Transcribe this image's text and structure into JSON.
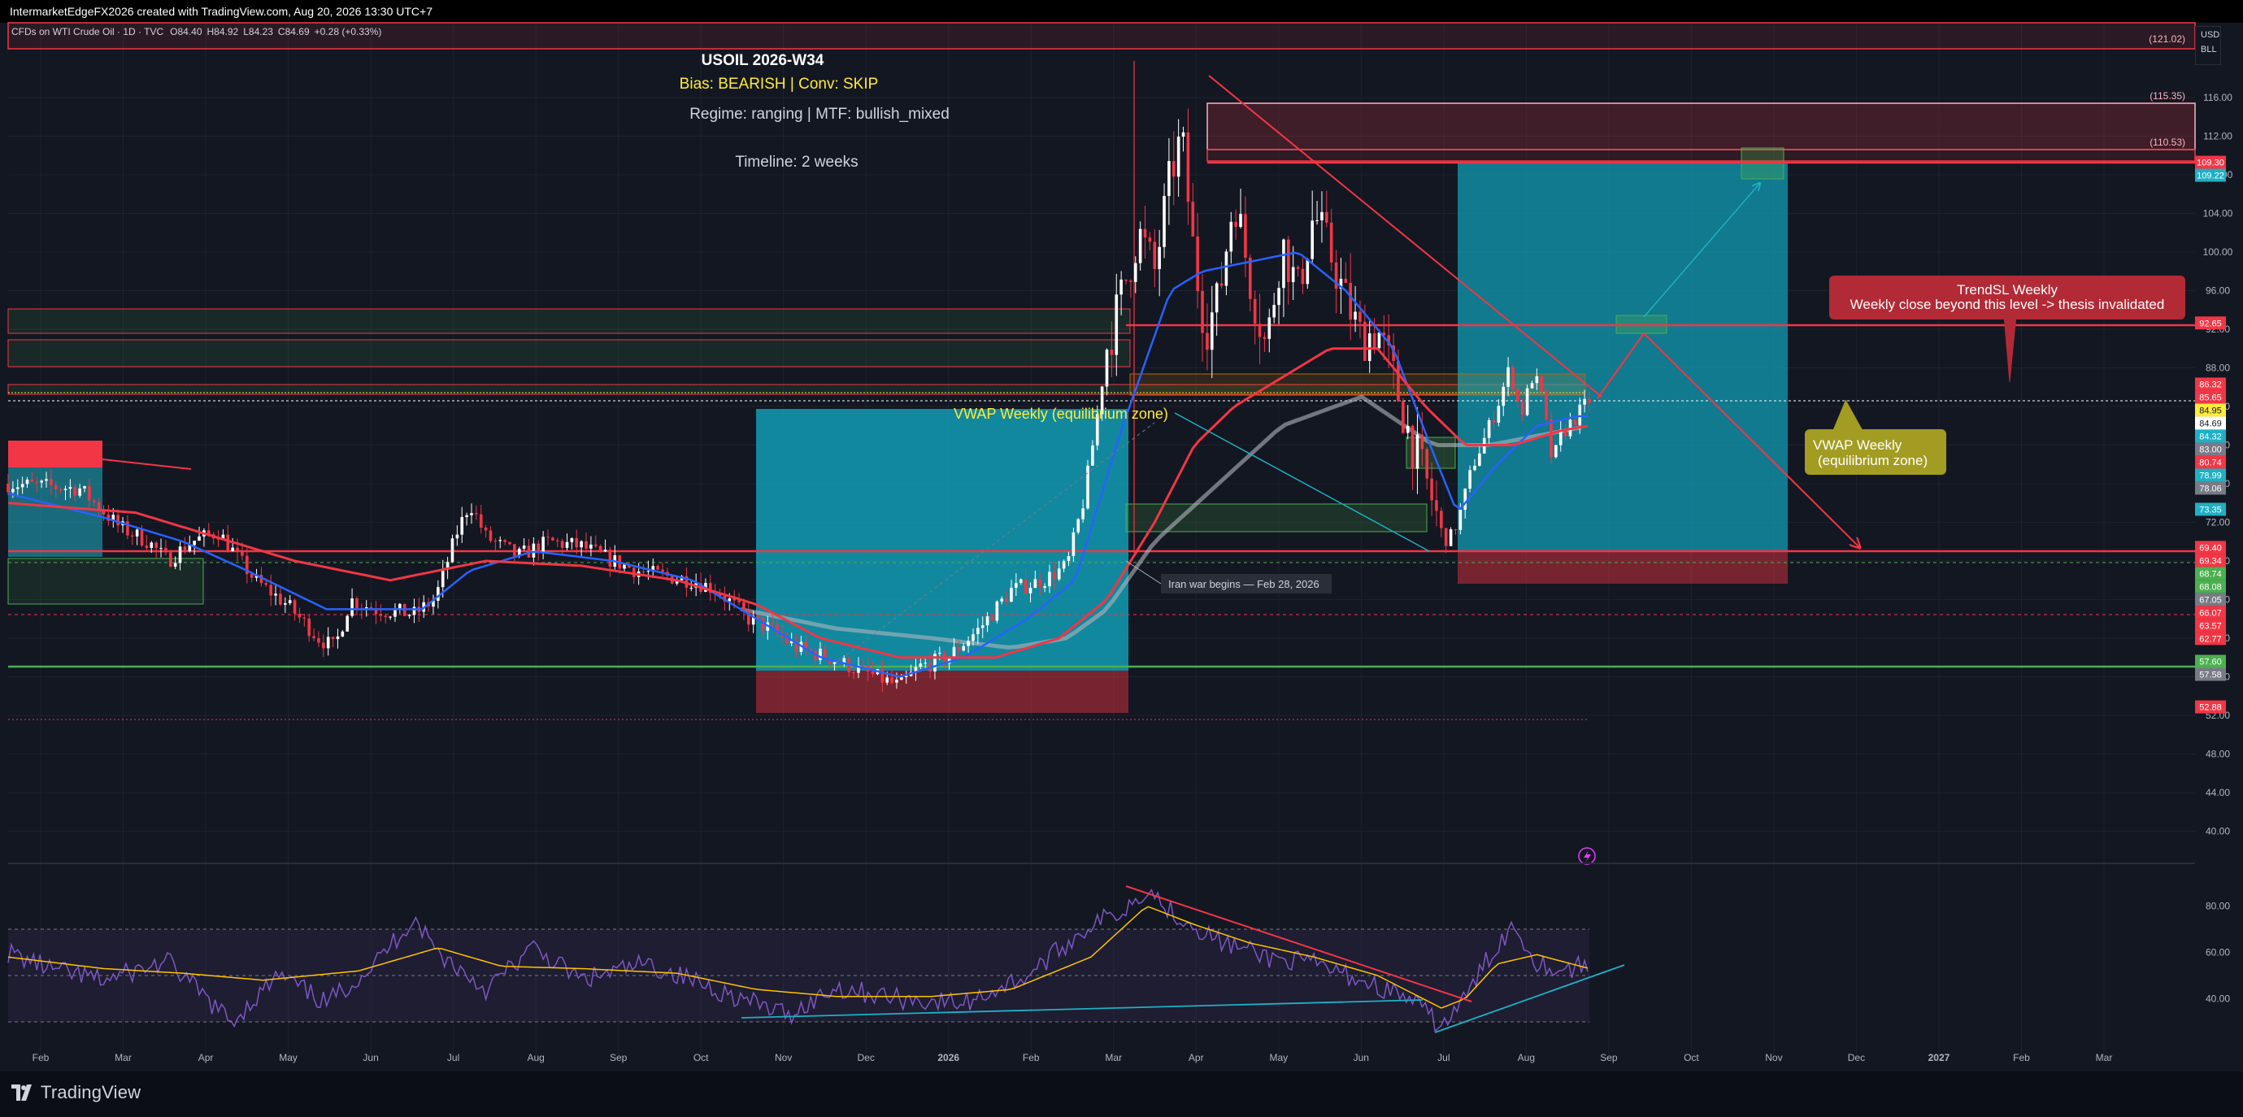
{
  "header": {
    "info": "IntermarketEdgeFX2026 created with TradingView.com, Aug 20, 2026 13:30 UTC+7"
  },
  "symbol_line": {
    "name": "CFDs on WTI Crude Oil · 1D · TVC",
    "o": "O84.40",
    "h": "H84.92",
    "l": "L84.23",
    "c": "C84.69",
    "chg": "+0.28 (+0.33%)"
  },
  "currency": {
    "top": "USD",
    "bottom": "BLL"
  },
  "footer": {
    "brand": "TradingView"
  },
  "colors": {
    "background": "#131722",
    "bull": "#ffffff",
    "bear": "#f23645",
    "accent_red": "#f23645",
    "accent_teal": "#1fb0c4",
    "accent_green": "#4caf50",
    "yellow_text": "#ffeb3b",
    "rsi": "#7e57c2"
  },
  "annotations": {
    "title": "USOIL 2026-W34",
    "bias": "Bias: BEARISH | Conv: SKIP",
    "regime": "Regime: ranging | MTF: bullish_mixed",
    "timeline": "Timeline: 2 weeks",
    "vwap_chart": "VWAP Weekly (equilibrium zone)",
    "vwap_callout_1": "VWAP Weekly",
    "vwap_callout_2": "(equilibrium zone)",
    "trendsl_1": "TrendSL Weekly",
    "trendsl_2": "Weekly close beyond this level -> thesis invalidated",
    "iran": "Iran war begins — Feb 28, 2026"
  },
  "zone_labels": [
    "(121.02)",
    "(115.35)",
    "(110.53)"
  ],
  "chart_data": [
    {
      "type": "candlestick",
      "x_labels": [
        "Feb",
        "Mar",
        "Apr",
        "May",
        "Jun",
        "Jul",
        "Aug",
        "Sep",
        "Oct",
        "Nov",
        "Dec",
        "2026",
        "Feb",
        "Mar",
        "Apr",
        "May",
        "Jun",
        "Jul",
        "Aug",
        "Sep",
        "Oct",
        "Nov",
        "Dec",
        "2027",
        "Feb",
        "Mar"
      ],
      "y_ticks": [
        "116.00",
        "112.00",
        "108.00",
        "104.00",
        "100.00",
        "96.00",
        "92.00",
        "88.00",
        "84.00",
        "80.00",
        "76.00",
        "72.00",
        "68.00",
        "64.00",
        "60.00",
        "56.00",
        "52.00",
        "48.00",
        "44.00",
        "40.00"
      ],
      "ylim": [
        38,
        122
      ],
      "last_price": 84.69,
      "price_badges": [
        {
          "label": "109.30",
          "color": "#f23645"
        },
        {
          "label": "109.22",
          "color": "#1fb0c4"
        },
        {
          "label": "92.65",
          "color": "#f23645"
        },
        {
          "label": "86.32",
          "color": "#f23645"
        },
        {
          "label": "85.65",
          "color": "#f23645"
        },
        {
          "label": "84.95",
          "color": "#ffeb3b"
        },
        {
          "label": "84.69",
          "color": "#ffffff"
        },
        {
          "label": "84.32",
          "color": "#1fb0c4"
        },
        {
          "label": "83.00",
          "color": "#787b86"
        },
        {
          "label": "80.74",
          "color": "#f23645"
        },
        {
          "label": "78.99",
          "color": "#1fb0c4"
        },
        {
          "label": "78.06",
          "color": "#787b86"
        },
        {
          "label": "73.35",
          "color": "#1fb0c4"
        },
        {
          "label": "69.40",
          "color": "#f23645"
        },
        {
          "label": "69.34",
          "color": "#f23645"
        },
        {
          "label": "68.74",
          "color": "#4caf50"
        },
        {
          "label": "68.08",
          "color": "#4caf50"
        },
        {
          "label": "67.05",
          "color": "#787b86"
        },
        {
          "label": "66.07",
          "color": "#f23645"
        },
        {
          "label": "63.57",
          "color": "#f23645"
        },
        {
          "label": "62.77",
          "color": "#f23645"
        },
        {
          "label": "57.60",
          "color": "#4caf50"
        },
        {
          "label": "57.58",
          "color": "#787b86"
        },
        {
          "label": "52.88",
          "color": "#f23645"
        }
      ],
      "close_anchors": [
        [
          0,
          76
        ],
        [
          45,
          75.5
        ],
        [
          70,
          71.5
        ],
        [
          88,
          70
        ],
        [
          100,
          68
        ],
        [
          115,
          70
        ],
        [
          132,
          71
        ],
        [
          155,
          66
        ],
        [
          175,
          63.5
        ],
        [
          195,
          60
        ],
        [
          205,
          59
        ],
        [
          215,
          64
        ],
        [
          230,
          63
        ],
        [
          255,
          62.5
        ],
        [
          268,
          64
        ],
        [
          282,
          71
        ],
        [
          290,
          74
        ],
        [
          300,
          70.5
        ],
        [
          320,
          68.5
        ],
        [
          340,
          70
        ],
        [
          360,
          69.5
        ],
        [
          380,
          68
        ],
        [
          395,
          67
        ],
        [
          410,
          66.5
        ],
        [
          430,
          66
        ],
        [
          445,
          65
        ],
        [
          465,
          62
        ],
        [
          478,
          61
        ],
        [
          495,
          59
        ],
        [
          515,
          58
        ],
        [
          530,
          57
        ],
        [
          545,
          56
        ],
        [
          560,
          55
        ],
        [
          572,
          57
        ],
        [
          590,
          58
        ],
        [
          610,
          61
        ],
        [
          630,
          65
        ],
        [
          650,
          66
        ],
        [
          665,
          67.5
        ],
        [
          675,
          74
        ],
        [
          683,
          82
        ],
        [
          690,
          90
        ],
        [
          700,
          96
        ],
        [
          710,
          102
        ],
        [
          720,
          98
        ],
        [
          730,
          108
        ],
        [
          737,
          112
        ],
        [
          745,
          99
        ],
        [
          752,
          92
        ],
        [
          760,
          95
        ],
        [
          770,
          106
        ],
        [
          780,
          97
        ],
        [
          790,
          90
        ],
        [
          800,
          101
        ],
        [
          810,
          96
        ],
        [
          820,
          104
        ],
        [
          830,
          100
        ],
        [
          840,
          95
        ],
        [
          850,
          91
        ],
        [
          860,
          92
        ],
        [
          870,
          87
        ],
        [
          880,
          81
        ],
        [
          893,
          75
        ],
        [
          900,
          71
        ],
        [
          905,
          70
        ],
        [
          912,
          73
        ],
        [
          920,
          78
        ],
        [
          928,
          81
        ],
        [
          935,
          84
        ],
        [
          943,
          88
        ],
        [
          950,
          83
        ],
        [
          957,
          87
        ],
        [
          962,
          86
        ],
        [
          970,
          78
        ],
        [
          975,
          81
        ],
        [
          985,
          83
        ],
        [
          993,
          84.69
        ]
      ],
      "sma_fast_anchors": [
        [
          0,
          75
        ],
        [
          60,
          72.5
        ],
        [
          110,
          70
        ],
        [
          150,
          67
        ],
        [
          200,
          63
        ],
        [
          260,
          63
        ],
        [
          290,
          67
        ],
        [
          330,
          69
        ],
        [
          380,
          68
        ],
        [
          430,
          66
        ],
        [
          470,
          62
        ],
        [
          510,
          58
        ],
        [
          560,
          56
        ],
        [
          600,
          58
        ],
        [
          640,
          62
        ],
        [
          670,
          66
        ],
        [
          700,
          82
        ],
        [
          730,
          96
        ],
        [
          750,
          98
        ],
        [
          780,
          99
        ],
        [
          810,
          100
        ],
        [
          840,
          96
        ],
        [
          870,
          90
        ],
        [
          893,
          80
        ],
        [
          910,
          73
        ],
        [
          935,
          78
        ],
        [
          960,
          82
        ],
        [
          985,
          83
        ],
        [
          993,
          83
        ]
      ],
      "sma_slow_anchors": [
        [
          0,
          74
        ],
        [
          80,
          73
        ],
        [
          120,
          71
        ],
        [
          180,
          68
        ],
        [
          240,
          66
        ],
        [
          300,
          68
        ],
        [
          360,
          67.5
        ],
        [
          420,
          66
        ],
        [
          470,
          63.5
        ],
        [
          510,
          60
        ],
        [
          560,
          58
        ],
        [
          620,
          58
        ],
        [
          660,
          60
        ],
        [
          690,
          64
        ],
        [
          720,
          72
        ],
        [
          745,
          80
        ],
        [
          770,
          84
        ],
        [
          800,
          87
        ],
        [
          830,
          90
        ],
        [
          860,
          90
        ],
        [
          890,
          84
        ],
        [
          915,
          80
        ],
        [
          945,
          80
        ],
        [
          975,
          81.5
        ],
        [
          993,
          82
        ]
      ],
      "vwap_band_anchors": [
        [
          460,
          63
        ],
        [
          520,
          61
        ],
        [
          580,
          60
        ],
        [
          630,
          59
        ],
        [
          665,
          60
        ],
        [
          690,
          63
        ],
        [
          720,
          70
        ],
        [
          760,
          76
        ],
        [
          800,
          82
        ],
        [
          850,
          85
        ],
        [
          895,
          80
        ],
        [
          930,
          80
        ],
        [
          993,
          82
        ]
      ],
      "annotated_levels": [
        121.02,
        115.35,
        110.53,
        92.65,
        84.95,
        69.4,
        57.6
      ]
    },
    {
      "type": "line",
      "name": "RSI",
      "y_ticks": [
        "80.00",
        "60.00",
        "40.00"
      ],
      "ylim": [
        15,
        100
      ],
      "bands": [
        70,
        50,
        30
      ],
      "rsi_anchors": [
        [
          0,
          60
        ],
        [
          30,
          52
        ],
        [
          60,
          48
        ],
        [
          100,
          56
        ],
        [
          140,
          30
        ],
        [
          170,
          50
        ],
        [
          200,
          38
        ],
        [
          230,
          55
        ],
        [
          255,
          75
        ],
        [
          270,
          60
        ],
        [
          300,
          44
        ],
        [
          330,
          62
        ],
        [
          360,
          48
        ],
        [
          400,
          55
        ],
        [
          430,
          48
        ],
        [
          460,
          40
        ],
        [
          490,
          33
        ],
        [
          520,
          45
        ],
        [
          560,
          40
        ],
        [
          600,
          38
        ],
        [
          640,
          50
        ],
        [
          680,
          72
        ],
        [
          700,
          78
        ],
        [
          715,
          88
        ],
        [
          730,
          78
        ],
        [
          760,
          65
        ],
        [
          790,
          58
        ],
        [
          820,
          55
        ],
        [
          850,
          48
        ],
        [
          880,
          40
        ],
        [
          900,
          28
        ],
        [
          915,
          40
        ],
        [
          930,
          58
        ],
        [
          945,
          72
        ],
        [
          960,
          56
        ],
        [
          975,
          52
        ],
        [
          993,
          55
        ]
      ],
      "signal_anchors": [
        [
          0,
          58
        ],
        [
          60,
          53
        ],
        [
          110,
          51
        ],
        [
          160,
          48
        ],
        [
          220,
          52
        ],
        [
          270,
          62
        ],
        [
          310,
          54
        ],
        [
          360,
          53
        ],
        [
          420,
          51
        ],
        [
          470,
          44
        ],
        [
          520,
          41
        ],
        [
          580,
          41
        ],
        [
          630,
          44
        ],
        [
          680,
          58
        ],
        [
          715,
          80
        ],
        [
          745,
          72
        ],
        [
          780,
          64
        ],
        [
          820,
          58
        ],
        [
          860,
          50
        ],
        [
          900,
          36
        ],
        [
          915,
          40
        ],
        [
          935,
          55
        ],
        [
          960,
          59
        ],
        [
          993,
          53
        ]
      ]
    }
  ]
}
